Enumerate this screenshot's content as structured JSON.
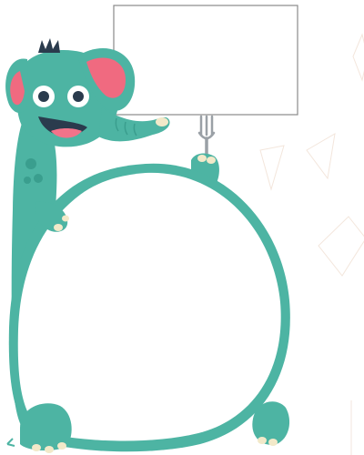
{
  "illustration": {
    "subject": "cartoon-elephant-holding-sign-and-frame",
    "colors": {
      "body": "#4db4a3",
      "body_shadow": "#3a9e8e",
      "ear_inner": "#f06a80",
      "mouth": "#2a3b4d",
      "tongue": "#f2738a",
      "eye_white": "#ffffff",
      "pupil": "#2a3b4d",
      "hair": "#2a3b4d",
      "toe": "#f2e9c9",
      "sign_border": "#8a8a8a",
      "fork": "#9aa0a6",
      "background": "#ffffff",
      "deco_lines": "#f3e6dc"
    },
    "sign": {
      "text": ""
    },
    "frame": {
      "text": ""
    }
  }
}
